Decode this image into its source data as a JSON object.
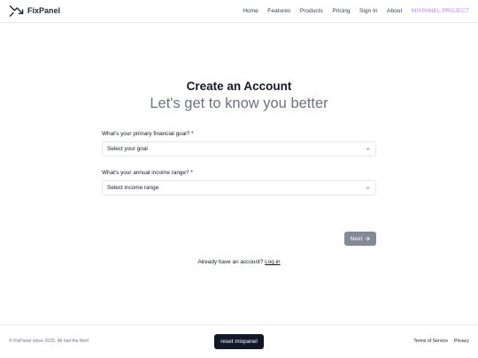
{
  "header": {
    "brand": "FixPanel",
    "nav": {
      "home": "Home",
      "features": "Features",
      "products": "Products",
      "pricing": "Pricing",
      "signin": "Sign In",
      "about": "About",
      "project": "MIXPANEL PROJECT"
    }
  },
  "main": {
    "title": "Create an Account",
    "subtitle": "Let's get to know you better",
    "goal": {
      "label": "What's your primary financial goal? *",
      "value": "Select your goal"
    },
    "income": {
      "label": "What's your annual income range? *",
      "value": "Select income range"
    },
    "next_label": "Next",
    "login_prompt": "Already have an account?",
    "login_link": "Log in"
  },
  "footer": {
    "copyright": "© FixPanel since 2025. All hail the thief.",
    "reset_label": "reset mixpanel",
    "terms": "Terms of Service",
    "privacy": "Privacy"
  },
  "colors": {
    "project_accent": "#c084fc",
    "next_button": "#838a96",
    "reset_button": "#111827"
  },
  "icons": [
    "trend-logo-icon",
    "chevron-down-icon",
    "arrow-right-icon"
  ]
}
